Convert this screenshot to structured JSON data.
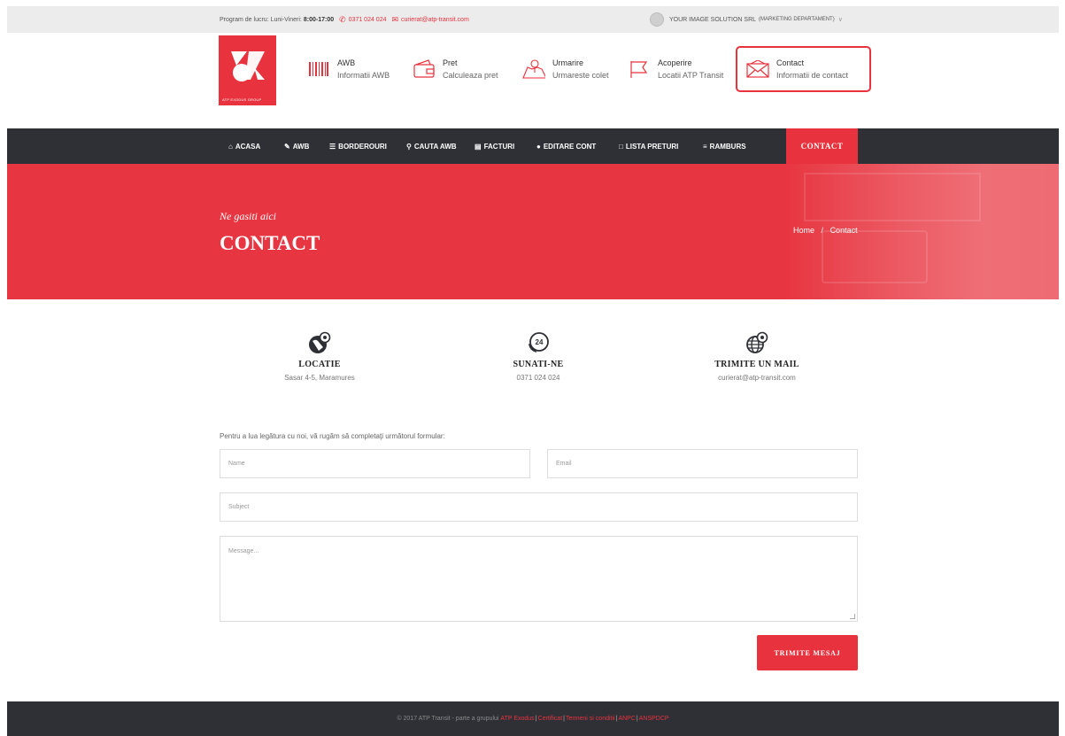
{
  "topbar": {
    "hours_label": "Program de lucru: Luni-Vineri:",
    "hours_value": "8:00-17:00",
    "phone": "0371 024 024",
    "email": "curierat@atp-transit.com",
    "user": "YOUR IMAGE SOLUTION SRL",
    "user_dept": "(MARKETING DEPARTAMENT)"
  },
  "logo": {
    "tagline": "ATP EXODUS GROUP"
  },
  "features": [
    {
      "title": "AWB",
      "subtitle": "Informatii AWB",
      "icon": "barcode-icon"
    },
    {
      "title": "Pret",
      "subtitle": "Calculeaza pret",
      "icon": "wallet-icon"
    },
    {
      "title": "Urmarire",
      "subtitle": "Urmareste colet",
      "icon": "map-pin-icon"
    },
    {
      "title": "Acoperire",
      "subtitle": "Locatii ATP Transit",
      "icon": "flag-icon"
    },
    {
      "title": "Contact",
      "subtitle": "Informatii de contact",
      "icon": "envelope-icon"
    }
  ],
  "nav": {
    "items": [
      {
        "label": "ACASA",
        "icon": "home-icon"
      },
      {
        "label": "AWB",
        "icon": "pencil-icon"
      },
      {
        "label": "BORDEROURI",
        "icon": "list-icon"
      },
      {
        "label": "CAUTA AWB",
        "icon": "search-icon"
      },
      {
        "label": "FACTURI",
        "icon": "invoice-icon"
      },
      {
        "label": "EDITARE CONT",
        "icon": "user-icon"
      },
      {
        "label": "LISTA PRETURI",
        "icon": "export-icon"
      },
      {
        "label": "RAMBURS",
        "icon": "bars-icon"
      }
    ],
    "active": "CONTACT"
  },
  "hero": {
    "subtitle": "Ne gasiti aici",
    "title": "CONTACT",
    "breadcrumb_home": "Home",
    "breadcrumb_sep": "/",
    "breadcrumb_current": "Contact"
  },
  "info": [
    {
      "heading": "LOCATIE",
      "value": "Sasar 4-5, Maramures",
      "icon": "globe-pin-icon"
    },
    {
      "heading": "SUNATI-NE",
      "value": "0371 024 024",
      "icon": "phone-24-icon"
    },
    {
      "heading": "TRIMITE UN MAIL",
      "value": "curierat@atp-transit.com",
      "icon": "web-pin-icon"
    }
  ],
  "form": {
    "intro": "Pentru a lua legătura cu noi, vă rugăm să completaţi următorul formular:",
    "name_placeholder": "Name",
    "email_placeholder": "Email",
    "subject_placeholder": "Subject",
    "message_placeholder": "Message...",
    "submit": "TRIMITE MESAJ"
  },
  "footer": {
    "text": "© 2017 ATP Transit - parte a grupului",
    "links": [
      "ATP Exodus",
      "Certificat",
      "Termeni si conditii",
      "ANPC",
      "ANSPDCP"
    ]
  },
  "colors": {
    "accent": "#e8323d",
    "dark": "#2e3036",
    "topbar": "#ececec"
  }
}
